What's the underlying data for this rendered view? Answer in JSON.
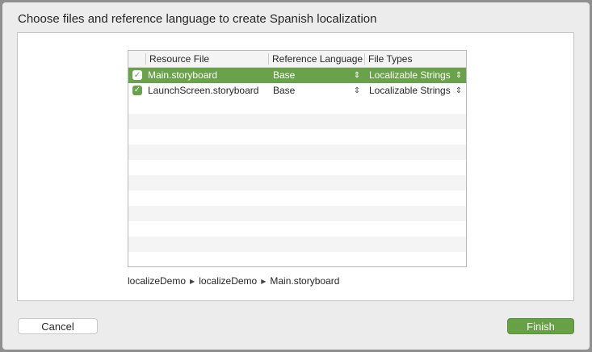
{
  "dialog": {
    "title": "Choose files and reference language to create Spanish localization"
  },
  "table": {
    "columns": {
      "resource_file": "Resource File",
      "reference_language": "Reference Language",
      "file_types": "File Types"
    },
    "rows": [
      {
        "checked": true,
        "resource_file": "Main.storyboard",
        "reference_language": "Base",
        "file_types": "Localizable Strings",
        "selected": true
      },
      {
        "checked": true,
        "resource_file": "LaunchScreen.storyboard",
        "reference_language": "Base",
        "file_types": "Localizable Strings",
        "selected": false
      }
    ]
  },
  "path": {
    "segments": [
      "localizeDemo",
      "localizeDemo",
      "Main.storyboard"
    ]
  },
  "buttons": {
    "cancel": "Cancel",
    "finish": "Finish"
  },
  "icons": {
    "checkbox": "checkmark-icon",
    "popup": "up-down-chevron-icon",
    "path_separator": "triangle-right-icon"
  },
  "colors": {
    "accent_green": "#6aa14b",
    "finish_button": "#67a045"
  }
}
